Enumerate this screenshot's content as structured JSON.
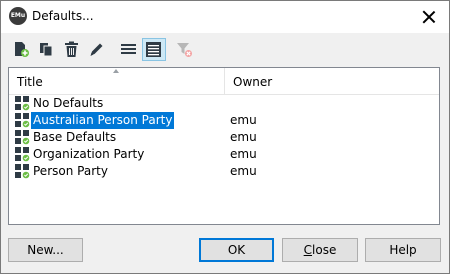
{
  "window": {
    "title": "Defaults...",
    "app_icon_text": "EMu"
  },
  "toolbar": {
    "buttons": [
      {
        "icon": "new-document-icon"
      },
      {
        "icon": "copy-icon"
      },
      {
        "icon": "delete-icon"
      },
      {
        "icon": "edit-pencil-icon"
      },
      {
        "icon": "list-view-icon"
      },
      {
        "icon": "details-view-icon",
        "active": true
      },
      {
        "icon": "clear-filter-icon",
        "disabled": true
      }
    ]
  },
  "table": {
    "columns": [
      "Title",
      "Owner"
    ],
    "rows": [
      {
        "title": "No Defaults",
        "owner": ""
      },
      {
        "title": "Australian Person Party",
        "owner": "emu",
        "selected": true
      },
      {
        "title": "Base Defaults",
        "owner": "emu"
      },
      {
        "title": "Organization Party",
        "owner": "emu"
      },
      {
        "title": "Person Party",
        "owner": "emu"
      }
    ]
  },
  "buttons": {
    "new": "New...",
    "ok": "OK",
    "close_underline": "C",
    "close_rest": "lose",
    "help": "Help"
  },
  "colors": {
    "selection": "#0078d7",
    "icon_dark": "#2f3b45",
    "icon_green": "#6cbe45"
  }
}
